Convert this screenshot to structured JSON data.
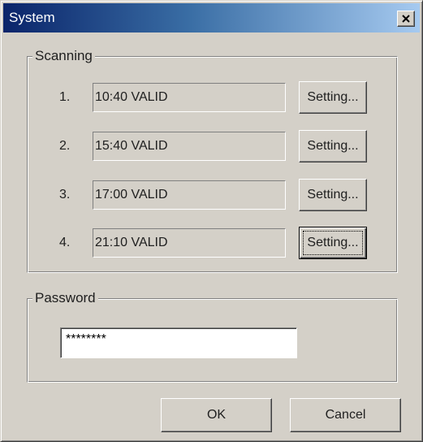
{
  "window": {
    "title": "System",
    "close_icon": "close-icon"
  },
  "scanning": {
    "label": "Scanning",
    "rows": [
      {
        "num": "1.",
        "value": "10:40  VALID",
        "button": "Setting..."
      },
      {
        "num": "2.",
        "value": "15:40  VALID",
        "button": "Setting..."
      },
      {
        "num": "3.",
        "value": "17:00  VALID",
        "button": "Setting..."
      },
      {
        "num": "4.",
        "value": "21:10  VALID",
        "button": "Setting..."
      }
    ]
  },
  "password": {
    "label": "Password",
    "value": "********"
  },
  "footer": {
    "ok_label": "OK",
    "cancel_label": "Cancel"
  },
  "colors": {
    "face": "#d4d0c8",
    "title_start": "#0a246a",
    "title_end": "#a6caf0"
  }
}
